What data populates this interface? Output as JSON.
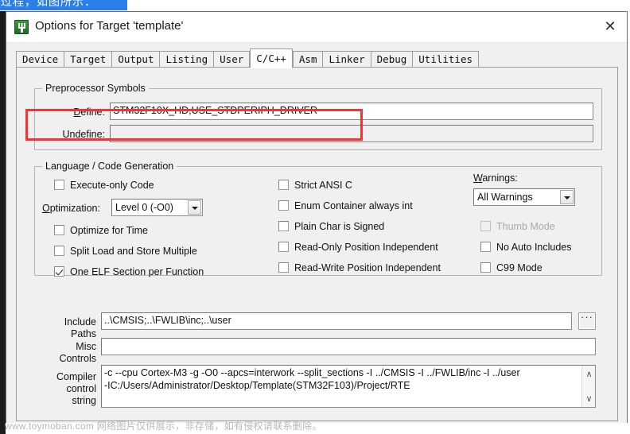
{
  "page_context": {
    "top_selection_text": "过程，如图所示：",
    "watermark": "www.toymoban.com 网络图片仅供展示，非存储，如有侵权请联系删除。"
  },
  "window": {
    "title": "Options for Target 'template'",
    "icon": "keil-uvision-icon",
    "close_label": "✕"
  },
  "tabs": [
    {
      "label": "Device",
      "selected": false
    },
    {
      "label": "Target",
      "selected": false
    },
    {
      "label": "Output",
      "selected": false
    },
    {
      "label": "Listing",
      "selected": false
    },
    {
      "label": "User",
      "selected": false
    },
    {
      "label": "C/C++",
      "selected": true
    },
    {
      "label": "Asm",
      "selected": false
    },
    {
      "label": "Linker",
      "selected": false
    },
    {
      "label": "Debug",
      "selected": false
    },
    {
      "label": "Utilities",
      "selected": false
    }
  ],
  "preprocessor": {
    "group_title": "Preprocessor Symbols",
    "define_label": "Define:",
    "define_value": "STM32F10X_HD,USE_STDPERIPH_DRIVER",
    "undefine_label": "Undefine:",
    "undefine_value": "",
    "highlight_color": "#f83232"
  },
  "language": {
    "group_title": "Language / Code Generation",
    "left_column": [
      {
        "label": "Execute-only Code",
        "checked": false,
        "enabled": true
      },
      {
        "label": "Optimize for Time",
        "checked": false,
        "enabled": true
      },
      {
        "label": "Split Load and Store Multiple",
        "checked": false,
        "enabled": true
      },
      {
        "label": "One ELF Section per Function",
        "checked": true,
        "enabled": true
      }
    ],
    "optimization_label": "Optimization:",
    "optimization_value": "Level 0 (-O0)",
    "middle_column": [
      {
        "label": "Strict ANSI C",
        "checked": false,
        "enabled": true
      },
      {
        "label": "Enum Container always int",
        "checked": false,
        "enabled": true
      },
      {
        "label": "Plain Char is Signed",
        "checked": false,
        "enabled": true
      },
      {
        "label": "Read-Only Position Independent",
        "checked": false,
        "enabled": true
      },
      {
        "label": "Read-Write Position Independent",
        "checked": false,
        "enabled": true
      }
    ],
    "warnings_label": "Warnings:",
    "warnings_value": "All Warnings",
    "right_column": [
      {
        "label": "Thumb Mode",
        "checked": false,
        "enabled": false
      },
      {
        "label": "No Auto Includes",
        "checked": false,
        "enabled": true
      },
      {
        "label": "C99 Mode",
        "checked": false,
        "enabled": true
      }
    ]
  },
  "paths": {
    "include_label_line1": "Include",
    "include_label_line2": "Paths",
    "include_value": "..\\CMSIS;..\\FWLIB\\inc;..\\user",
    "browse_label": "...",
    "misc_label_line1": "Misc",
    "misc_label_line2": "Controls",
    "misc_value": ""
  },
  "compiler": {
    "label_line1": "Compiler",
    "label_line2": "control",
    "label_line3": "string",
    "lines": [
      "-c --cpu Cortex-M3 -g -O0 --apcs=interwork --split_sections -I ../CMSIS -I ../FWLIB/inc -I ../user",
      "-IC:/Users/Administrator/Desktop/Template(STM32F103)/Project/RTE"
    ],
    "scroll_up": "∧",
    "scroll_down": "∨"
  }
}
